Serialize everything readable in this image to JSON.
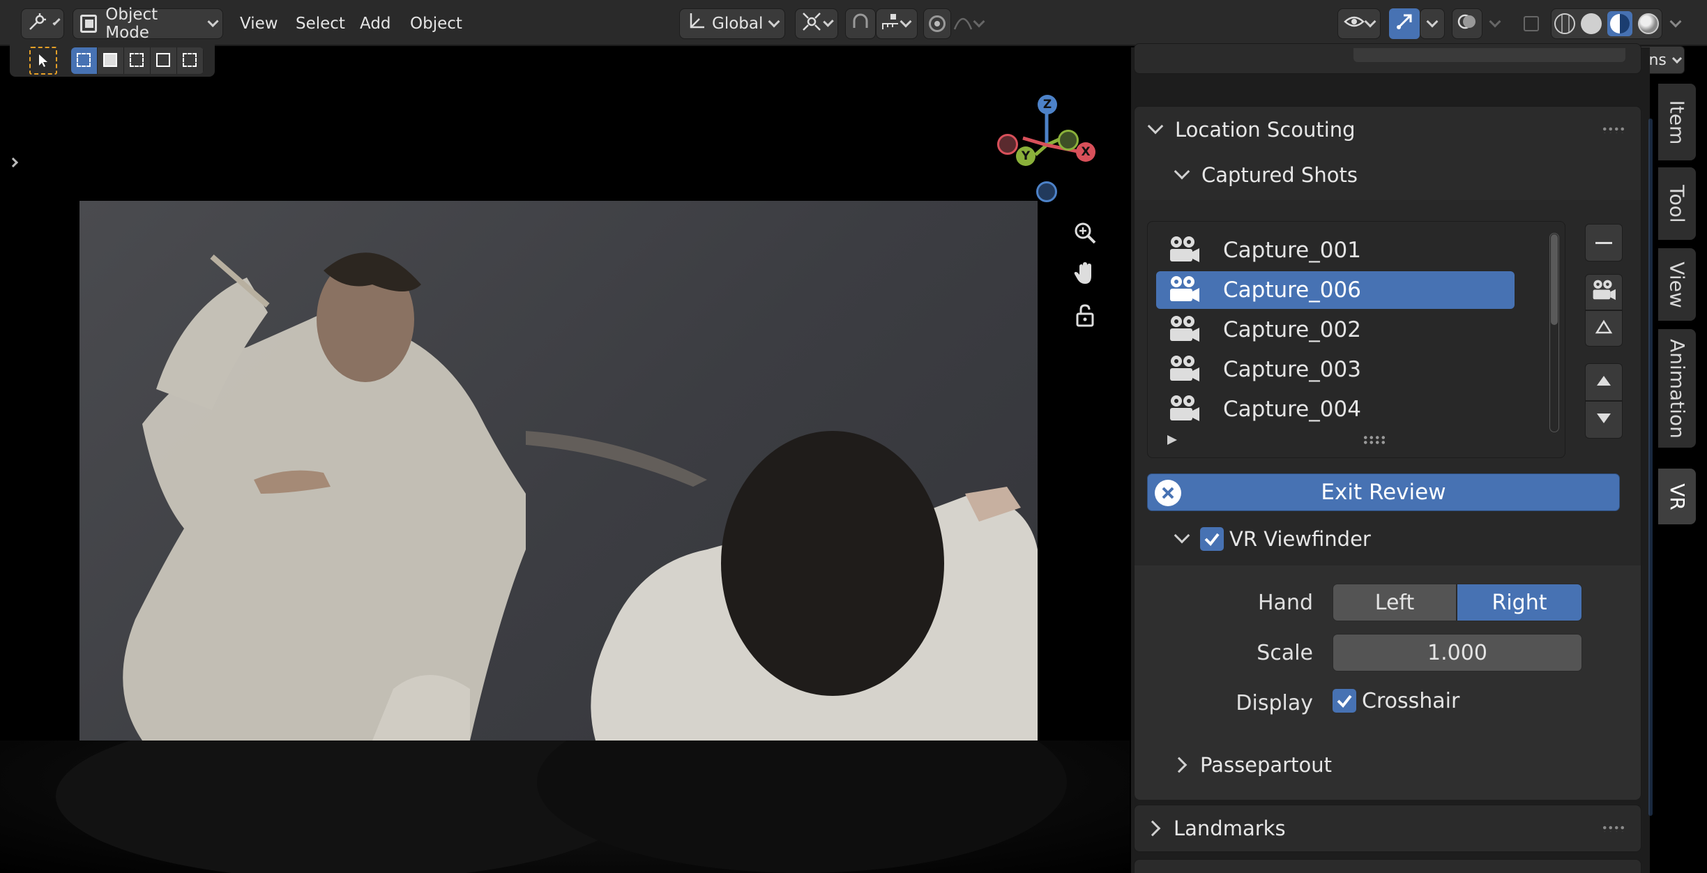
{
  "header": {
    "editor_type_icon": "viewport-editor-icon",
    "mode": "Object Mode",
    "menus": [
      "View",
      "Select",
      "Add",
      "Object"
    ],
    "transform_orientation": "Global",
    "options_label": "Options"
  },
  "panel": {
    "title": "Location Scouting",
    "captured_shots": {
      "title": "Captured Shots",
      "items": [
        "Capture_001",
        "Capture_006",
        "Capture_002",
        "Capture_003",
        "Capture_004"
      ],
      "active_index": 1
    },
    "exit_review_label": "Exit Review",
    "vr_viewfinder": {
      "title": "VR Viewfinder",
      "enabled": true,
      "hand_label": "Hand",
      "hand_options": [
        "Left",
        "Right"
      ],
      "hand_selected": "Right",
      "scale_label": "Scale",
      "scale_value": "1.000",
      "display_label": "Display",
      "crosshair_label": "Crosshair",
      "crosshair_enabled": true
    },
    "passepartout_title": "Passepartout",
    "landmarks_title": "Landmarks"
  },
  "gizmo": {
    "z": "Z",
    "y": "Y",
    "x": "X"
  },
  "tabs": [
    "Item",
    "Tool",
    "View",
    "Animation",
    "VR"
  ],
  "active_tab": "VR",
  "colors": {
    "accent": "#4772b3",
    "axis_x": "#d8505a",
    "axis_y": "#8ab03a",
    "axis_z": "#4d82c8"
  }
}
